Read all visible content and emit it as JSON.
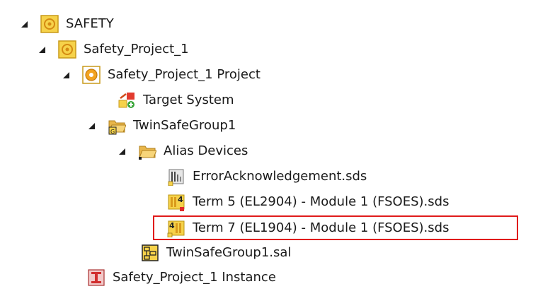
{
  "tree": {
    "nodes": [
      {
        "id": "safety",
        "label": "SAFETY",
        "icon": "safety-folder-icon",
        "expanded": true
      },
      {
        "id": "project",
        "label": "Safety_Project_1",
        "icon": "safety-project-icon",
        "expanded": true
      },
      {
        "id": "project-project",
        "label": "Safety_Project_1 Project",
        "icon": "safety-project-gear-icon",
        "expanded": true
      },
      {
        "id": "target",
        "label": "Target System",
        "icon": "target-system-icon"
      },
      {
        "id": "group",
        "label": "TwinSafeGroup1",
        "icon": "group-folder-icon",
        "expanded": true
      },
      {
        "id": "alias",
        "label": "Alias Devices",
        "icon": "open-folder-icon",
        "expanded": true
      },
      {
        "id": "erroracknowledgement",
        "label": "ErrorAcknowledgement.sds",
        "icon": "sds-device-icon"
      },
      {
        "id": "term5",
        "label": "Term 5 (EL2904) - Module 1 (FSOES).sds",
        "icon": "sds-output-icon"
      },
      {
        "id": "term7",
        "label": "Term 7 (EL1904) - Module 1 (FSOES).sds",
        "icon": "sds-input-icon",
        "selected": true
      },
      {
        "id": "sal",
        "label": "TwinSafeGroup1.sal",
        "icon": "sal-file-icon"
      },
      {
        "id": "instance",
        "label": "Safety_Project_1 Instance",
        "icon": "instance-icon"
      }
    ]
  },
  "colors": {
    "icon_yellow": "#f6d24a",
    "icon_orange": "#d99a1c",
    "highlight_border": "#e01b1b"
  }
}
